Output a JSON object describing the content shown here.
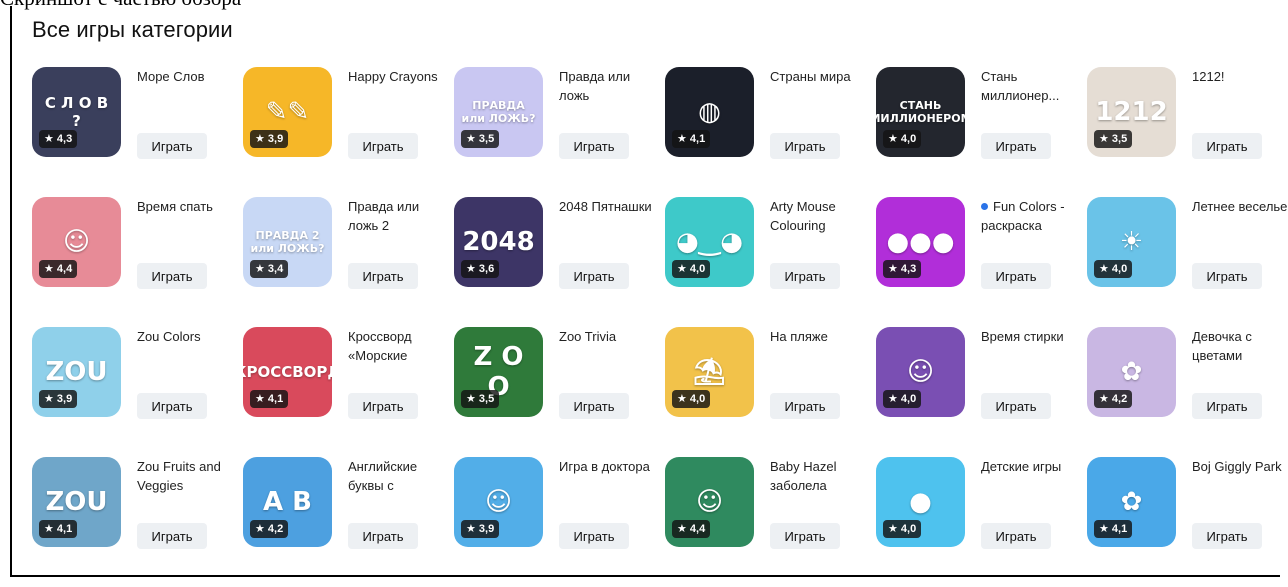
{
  "top_cut_text": "Скриншот с частью обзора",
  "section_title": "Все игры категории",
  "play_label": "Играть",
  "games": [
    {
      "name": "Море Слов",
      "rating": "★ 4,3",
      "art": "С Л О В ?",
      "icon": "word-circle-icon",
      "color": "#3a3f5c"
    },
    {
      "name": "Happy Crayons",
      "rating": "★ 3,9",
      "art": "✎✎",
      "icon": "crayons-icon",
      "color": "#f6b728"
    },
    {
      "name": "Правда или ложь",
      "rating": "★ 3,5",
      "art": "ПРАВДА или ЛОЖЬ?",
      "icon": "truth-or-lie-icon",
      "color": "#c9c7f2"
    },
    {
      "name": "Страны мира",
      "rating": "★ 4,1",
      "art": "◍",
      "icon": "world-flags-icon",
      "color": "#1b1f2a"
    },
    {
      "name": "Стань миллионер...",
      "rating": "★ 4,0",
      "art": "СТАНЬ МИЛЛИОНЕРОМ",
      "icon": "millionaire-icon",
      "color": "#23262e"
    },
    {
      "name": "1212!",
      "rating": "★ 3,5",
      "art": "1212",
      "icon": "number-blocks-icon",
      "color": "#e5ddd4"
    },
    {
      "name": "Время спать",
      "rating": "★ 4,4",
      "art": "☺",
      "icon": "baby-sleep-icon",
      "color": "#e78b97"
    },
    {
      "name": "Правда или ложь 2",
      "rating": "★ 3,4",
      "art": "ПРАВДА 2 или ЛОЖЬ?",
      "icon": "truth-or-lie-2-icon",
      "color": "#c8d8f5"
    },
    {
      "name": "2048 Пятнашки",
      "rating": "★ 3,6",
      "art": "2048",
      "icon": "2048-tiles-icon",
      "color": "#3d3566"
    },
    {
      "name": "Arty Mouse Colouring",
      "rating": "★ 4,0",
      "art": "◕‿◕",
      "icon": "mouse-icon",
      "color": "#3ec9c9"
    },
    {
      "name": "Fun Colors - раскраска",
      "rating": "★ 4,3",
      "art": "●●●",
      "icon": "palette-icon",
      "color": "#b12ed9",
      "dot": true
    },
    {
      "name": "Летнее веселье",
      "rating": "★ 4,0",
      "art": "☀",
      "icon": "summer-girl-icon",
      "color": "#6ac3e8"
    },
    {
      "name": "Zou Colors",
      "rating": "★ 3,9",
      "art": "ZOU",
      "icon": "zebra-icon",
      "color": "#8fd0ea"
    },
    {
      "name": "Кроссворд «Морские",
      "rating": "★ 4,1",
      "art": "КРОССВОРД",
      "icon": "crab-icon",
      "color": "#d94a5c"
    },
    {
      "name": "Zoo Trivia",
      "rating": "★ 3,5",
      "art": "Z O O",
      "icon": "zoo-letters-icon",
      "color": "#2f7a3a"
    },
    {
      "name": "На пляже",
      "rating": "★ 4,0",
      "art": "⛱",
      "icon": "beach-icon",
      "color": "#f2c24a"
    },
    {
      "name": "Время стирки",
      "rating": "★ 4,0",
      "art": "☺",
      "icon": "laundry-girl-icon",
      "color": "#7a4fb3"
    },
    {
      "name": "Девочка с цветами",
      "rating": "★ 4,2",
      "art": "✿",
      "icon": "flower-girl-icon",
      "color": "#c9b7e3"
    },
    {
      "name": "Zou Fruits and Veggies",
      "rating": "★ 4,1",
      "art": "ZOU",
      "icon": "zebra-icon",
      "color": "#6fa6c9"
    },
    {
      "name": "Английские буквы с",
      "rating": "★ 4,2",
      "art": "A B",
      "icon": "cat-letters-icon",
      "color": "#4da0e0"
    },
    {
      "name": "Игра в доктора",
      "rating": "★ 3,9",
      "art": "☺",
      "icon": "doctor-girl-icon",
      "color": "#52aee8"
    },
    {
      "name": "Baby Hazel заболела",
      "rating": "★ 4,4",
      "art": "☺",
      "icon": "sick-baby-icon",
      "color": "#2f8a5f"
    },
    {
      "name": "Детские игры",
      "rating": "★ 4,0",
      "art": "●",
      "icon": "balloon-icon",
      "color": "#4ec2ee"
    },
    {
      "name": "Boj Giggly Park",
      "rating": "★ 4,1",
      "art": "✿",
      "icon": "bunny-icon",
      "color": "#4aa8e8"
    }
  ]
}
